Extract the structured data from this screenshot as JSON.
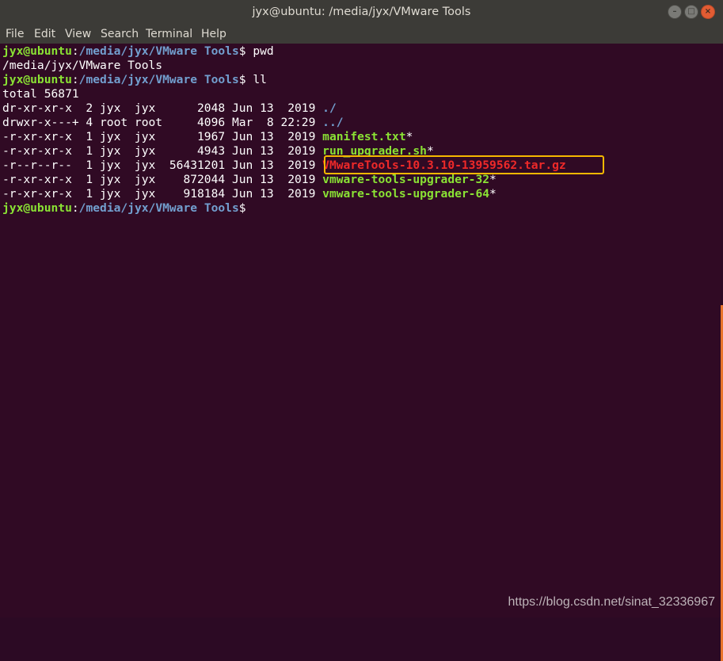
{
  "window": {
    "title": "jyx@ubuntu: /media/jyx/VMware Tools",
    "buttons": {
      "minimize": "–",
      "maximize": "□",
      "close": "×"
    }
  },
  "menu": [
    "File",
    "Edit",
    "View",
    "Search",
    "Terminal",
    "Help"
  ],
  "prompt": {
    "user": "jyx@ubuntu",
    "path": "/media/jyx/VMware Tools",
    "symbol": "$"
  },
  "terminal": {
    "cmd1": "pwd",
    "out1": "/media/jyx/VMware Tools",
    "cmd2": "ll",
    "total": "total 56871",
    "rows": [
      {
        "meta": "dr-xr-xr-x  2 jyx  jyx      2048 Jun 13  2019 ",
        "name": "./",
        "suffix": "",
        "kind": "dir"
      },
      {
        "meta": "drwxr-x---+ 4 root root     4096 Mar  8 22:29 ",
        "name": "../",
        "suffix": "",
        "kind": "dir"
      },
      {
        "meta": "-r-xr-xr-x  1 jyx  jyx      1967 Jun 13  2019 ",
        "name": "manifest.txt",
        "suffix": "*",
        "kind": "exec"
      },
      {
        "meta": "-r-xr-xr-x  1 jyx  jyx      4943 Jun 13  2019 ",
        "name": "run_upgrader.sh",
        "suffix": "*",
        "kind": "exec"
      },
      {
        "meta": "-r--r--r--  1 jyx  jyx  56431201 Jun 13  2019 ",
        "name": "VMwareTools-10.3.10-13959562.tar.gz",
        "suffix": "",
        "kind": "archive"
      },
      {
        "meta": "-r-xr-xr-x  1 jyx  jyx    872044 Jun 13  2019 ",
        "name": "vmware-tools-upgrader-32",
        "suffix": "*",
        "kind": "exec"
      },
      {
        "meta": "-r-xr-xr-x  1 jyx  jyx    918184 Jun 13  2019 ",
        "name": "vmware-tools-upgrader-64",
        "suffix": "*",
        "kind": "exec"
      }
    ]
  },
  "colors": {
    "background": "#300a24",
    "user": "#8ae234",
    "path": "#729fcf",
    "executable": "#8ae234",
    "archive": "#ef2929",
    "highlight": "#f5b800"
  },
  "watermark": "https://blog.csdn.net/sinat_32336967"
}
